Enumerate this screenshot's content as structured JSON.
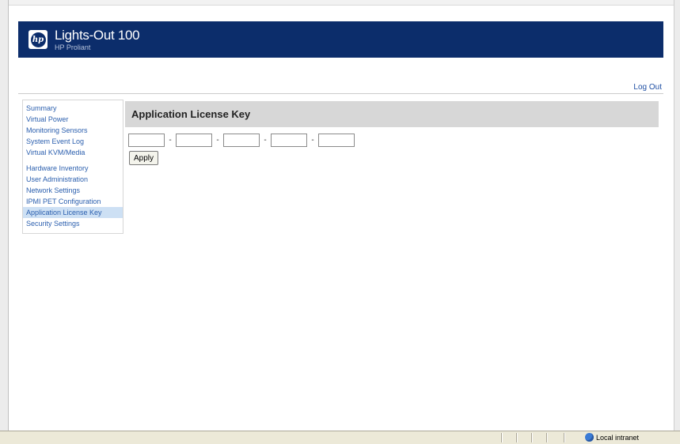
{
  "header": {
    "product": "Lights-Out 100",
    "subtitle": "HP Proliant",
    "logo_text": "hp"
  },
  "logout_label": "Log Out",
  "sidebar": {
    "groups": [
      [
        "Summary",
        "Virtual Power",
        "Monitoring Sensors",
        "System Event Log",
        "Virtual KVM/Media"
      ],
      [
        "Hardware Inventory",
        "User Administration",
        "Network Settings",
        "IPMI PET Configuration",
        "Application License Key",
        "Security Settings"
      ]
    ],
    "active": "Application License Key"
  },
  "main": {
    "title": "Application License Key",
    "key_fields": [
      "",
      "",
      "",
      "",
      ""
    ],
    "separator": "-",
    "apply_label": "Apply"
  },
  "statusbar": {
    "zone_label": "Local intranet"
  },
  "colors": {
    "banner": "#0c2d6b",
    "link": "#2b5fae",
    "active_bg": "#cde0f4",
    "section_header": "#d7d7d7"
  }
}
